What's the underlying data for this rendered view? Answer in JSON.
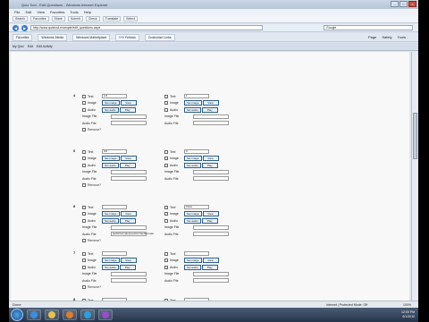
{
  "browser": {
    "title": "Quiz Tool - Edit Questions - Windows Internet Explorer",
    "menu": [
      "File",
      "Edit",
      "View",
      "Favorites",
      "Tools",
      "Help"
    ],
    "toolbar_items": [
      "Search",
      "Favorites",
      "Share",
      "Submit",
      "Check",
      "Translate",
      "Select"
    ],
    "address": "http://www.quiztool.example/edit_questions.aspx",
    "search_placeholder": "Google",
    "favorites": [
      "Favorites",
      "Windows Media",
      "Windows Marketplace",
      "IYV Fellows",
      "Customize Links"
    ],
    "commands": [
      "Page",
      "Safety",
      "Tools"
    ],
    "tabs": [
      "My Quiz",
      "Edit",
      "Edit Activity"
    ]
  },
  "labels": {
    "text": "Text",
    "image": "Image",
    "audio": "Audio",
    "image_file": "Image File",
    "audio_file": "Audio File",
    "set_image": "Set image",
    "set_audio": "Set audio",
    "play": "Play",
    "view": "View",
    "remove": "Remove?"
  },
  "questions": [
    {
      "number": "4",
      "left_text": "1/2",
      "right_text": "1",
      "left_audio_file": "",
      "right_audio_file": ""
    },
    {
      "number": "6",
      "left_text": "3/4",
      "right_text": "3",
      "left_audio_file": "",
      "right_audio_file": ""
    },
    {
      "number": "8",
      "left_text": "",
      "right_text": "Voice",
      "left_audio_file": "audio/sample/question/audio4.wav",
      "right_audio_file": ""
    },
    {
      "number": "7",
      "left_text": "",
      "right_text": "",
      "left_audio_file": "",
      "right_audio_file": ""
    },
    {
      "number": "8",
      "left_text": "",
      "right_text": "",
      "left_audio_file": "",
      "right_audio_file": ""
    }
  ],
  "status": {
    "left": "Done",
    "zone": "Internet | Protected Mode: Off",
    "zoom": "100%"
  },
  "taskbar": {
    "time": "12:00 PM",
    "date": "6/1/2010"
  },
  "colors": {
    "title_bar": "#b6c6d8",
    "button_border": "#2b5e8e",
    "taskbar": "#25344a"
  }
}
